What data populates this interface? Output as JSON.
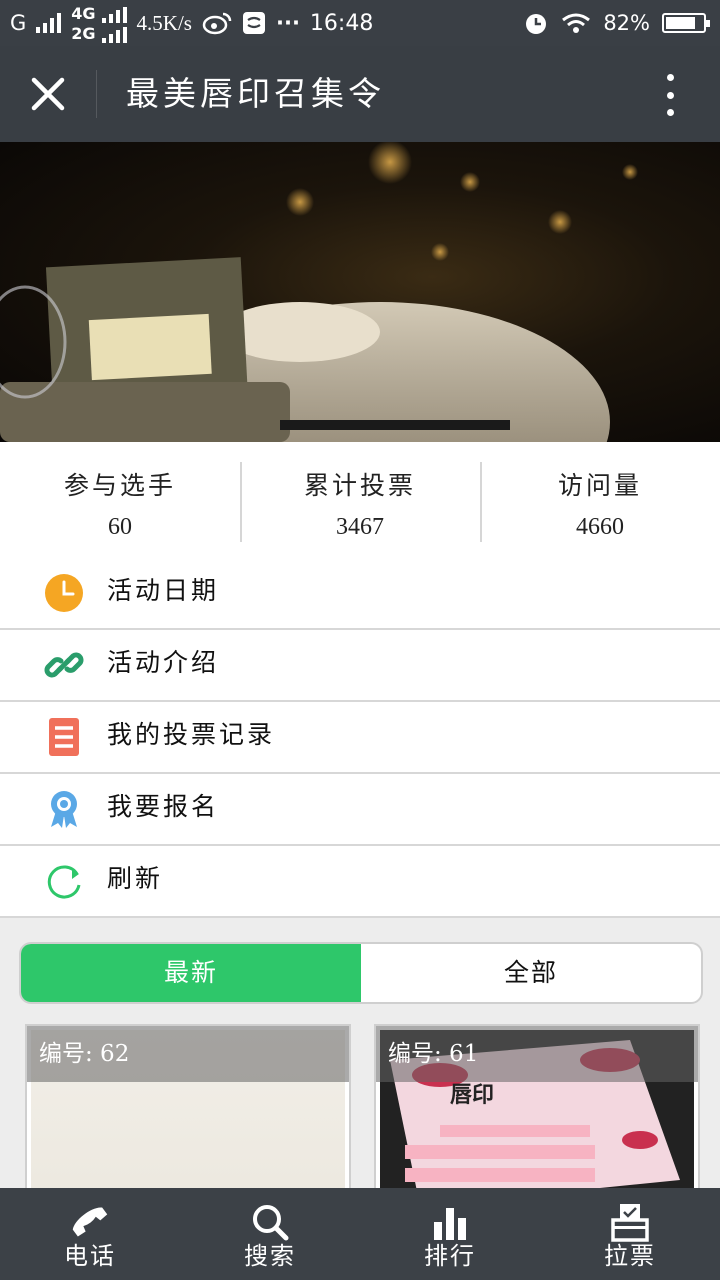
{
  "status_bar": {
    "carrier1": "G",
    "net_top": "4G",
    "net_bottom": "2G",
    "speed": "4.5K/s",
    "more": "···",
    "time": "16:48",
    "battery": "82%",
    "battery_level": 0.82
  },
  "header": {
    "title": "最美唇印召集令"
  },
  "stats": [
    {
      "label": "参与选手",
      "value": "60"
    },
    {
      "label": "累计投票",
      "value": "3467"
    },
    {
      "label": "访问量",
      "value": "4660"
    }
  ],
  "menu": [
    {
      "label": "活动日期",
      "icon": "clock-icon",
      "color": "#f5a623"
    },
    {
      "label": "活动介绍",
      "icon": "link-icon",
      "color": "#2a9d6b"
    },
    {
      "label": "我的投票记录",
      "icon": "list-icon",
      "color": "#f0705a"
    },
    {
      "label": "我要报名",
      "icon": "award-icon",
      "color": "#5aa8e6"
    },
    {
      "label": "刷新",
      "icon": "refresh-icon",
      "color": "#2ec76a"
    }
  ],
  "tabs": {
    "latest": "最新",
    "all": "全部"
  },
  "cards": [
    {
      "caption": "编号: 62"
    },
    {
      "caption": "编号: 61"
    }
  ],
  "bottom_nav": [
    {
      "label": "电话",
      "icon": "phone-icon"
    },
    {
      "label": "搜索",
      "icon": "search-icon"
    },
    {
      "label": "排行",
      "icon": "bar-chart-icon"
    },
    {
      "label": "拉票",
      "icon": "ballot-box-icon"
    }
  ],
  "colors": {
    "accent_green": "#2ec76a",
    "nav_bg": "#393e44"
  }
}
